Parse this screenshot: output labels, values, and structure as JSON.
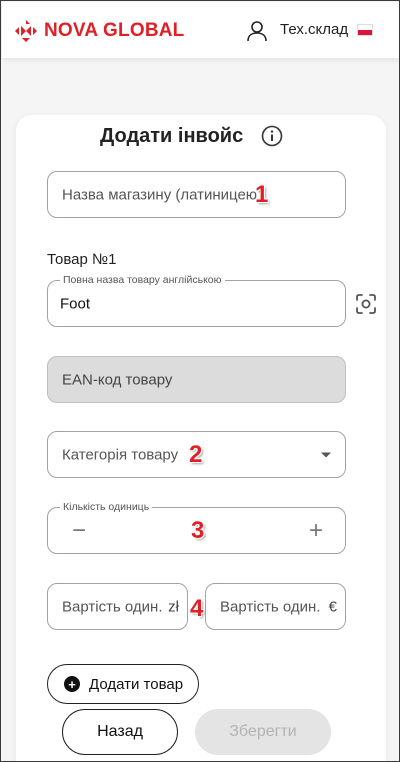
{
  "header": {
    "brand": "NOVA GLOBAL",
    "user_name": "Тех.склад",
    "flag": "Poland"
  },
  "form": {
    "title": "Додати інвойс",
    "store_name_placeholder": "Назва магазину (латиницею)",
    "item_label": "Товар №1",
    "product_name_legend": "Повна назва товару англійською",
    "product_name_value": "Foot",
    "ean_placeholder": "EAN-код товару",
    "category_placeholder": "Категорія товару",
    "quantity_legend": "Кількість одиниць",
    "quantity_minus": "−",
    "quantity_plus": "+",
    "unit_price_pln_placeholder": "Вартість один.",
    "unit_price_pln_currency": "zł",
    "unit_price_eur_placeholder": "Вартість один.",
    "unit_price_eur_currency": "€",
    "add_item_label": "Додати товар"
  },
  "footer": {
    "back_label": "Назад",
    "save_label": "Зберегти"
  },
  "markers": [
    "1",
    "2",
    "3",
    "4"
  ],
  "colors": {
    "brand_red": "#e01f26",
    "disabled_bg": "#dcdcdc"
  }
}
